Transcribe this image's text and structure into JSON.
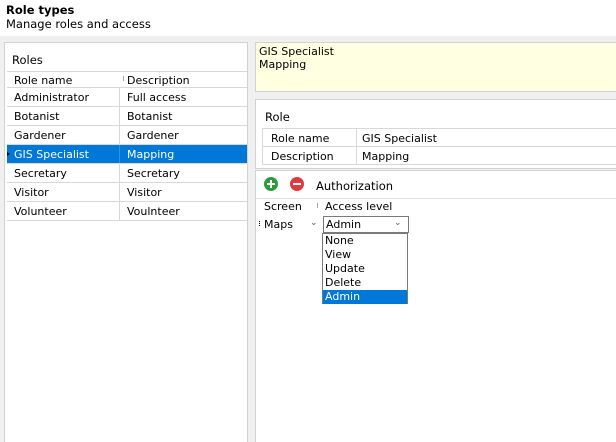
{
  "header": {
    "title": "Role types",
    "subtitle": "Manage roles and access"
  },
  "roles": {
    "title": "Roles",
    "columns": [
      "Role name",
      "Description"
    ],
    "rows": [
      {
        "name": "Administrator",
        "description": "Full access"
      },
      {
        "name": "Botanist",
        "description": "Botanist"
      },
      {
        "name": "Gardener",
        "description": "Gardener"
      },
      {
        "name": "GIS Specialist",
        "description": "Mapping"
      },
      {
        "name": "Secretary",
        "description": "Secretary"
      },
      {
        "name": "Visitor",
        "description": "Visitor"
      },
      {
        "name": "Volunteer",
        "description": "Voulnteer"
      }
    ],
    "selected_index": 3
  },
  "note": {
    "line1": "GIS Specialist",
    "line2": "Mapping"
  },
  "role": {
    "title": "Role",
    "name_label": "Role name",
    "name_value": "GIS Specialist",
    "description_label": "Description",
    "description_value": "Mapping"
  },
  "authorization": {
    "title": "Authorization",
    "add_icon": "plus-circle-icon",
    "remove_icon": "minus-circle-icon",
    "columns": [
      "Screen",
      "Access level"
    ],
    "row": {
      "screen": "Maps",
      "access_level": "Admin"
    },
    "access_options": [
      "None",
      "View",
      "Update",
      "Delete",
      "Admin"
    ],
    "selected_option": "Admin"
  },
  "colors": {
    "selection": "#0078d7",
    "note_background": "#ffffe1",
    "add_button": "#2e9a3e",
    "remove_button": "#e0393e"
  }
}
